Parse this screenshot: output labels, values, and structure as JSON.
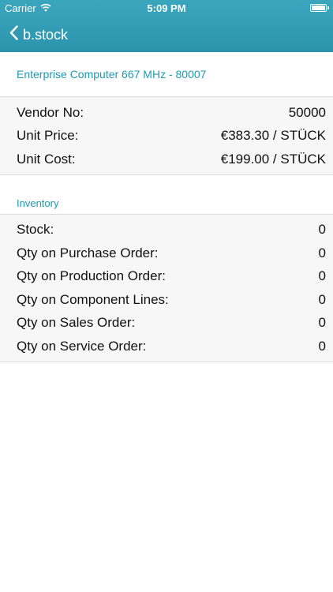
{
  "status_bar": {
    "carrier": "Carrier",
    "time": "5:09 PM"
  },
  "nav": {
    "back_label": "b.stock"
  },
  "product": {
    "title": "Enterprise Computer 667 MHz - 80007"
  },
  "details": [
    {
      "label": "Vendor No:",
      "value": "50000"
    },
    {
      "label": "Unit Price:",
      "value": "€383.30 / STÜCK"
    },
    {
      "label": "Unit Cost:",
      "value": "€199.00 / STÜCK"
    }
  ],
  "inventory": {
    "header": "Inventory",
    "rows": [
      {
        "label": "Stock:",
        "value": "0"
      },
      {
        "label": "Qty on Purchase Order:",
        "value": "0"
      },
      {
        "label": "Qty on Production Order:",
        "value": "0"
      },
      {
        "label": "Qty on Component Lines:",
        "value": "0"
      },
      {
        "label": "Qty on Sales Order:",
        "value": "0"
      },
      {
        "label": "Qty on Service Order:",
        "value": "0"
      }
    ]
  }
}
